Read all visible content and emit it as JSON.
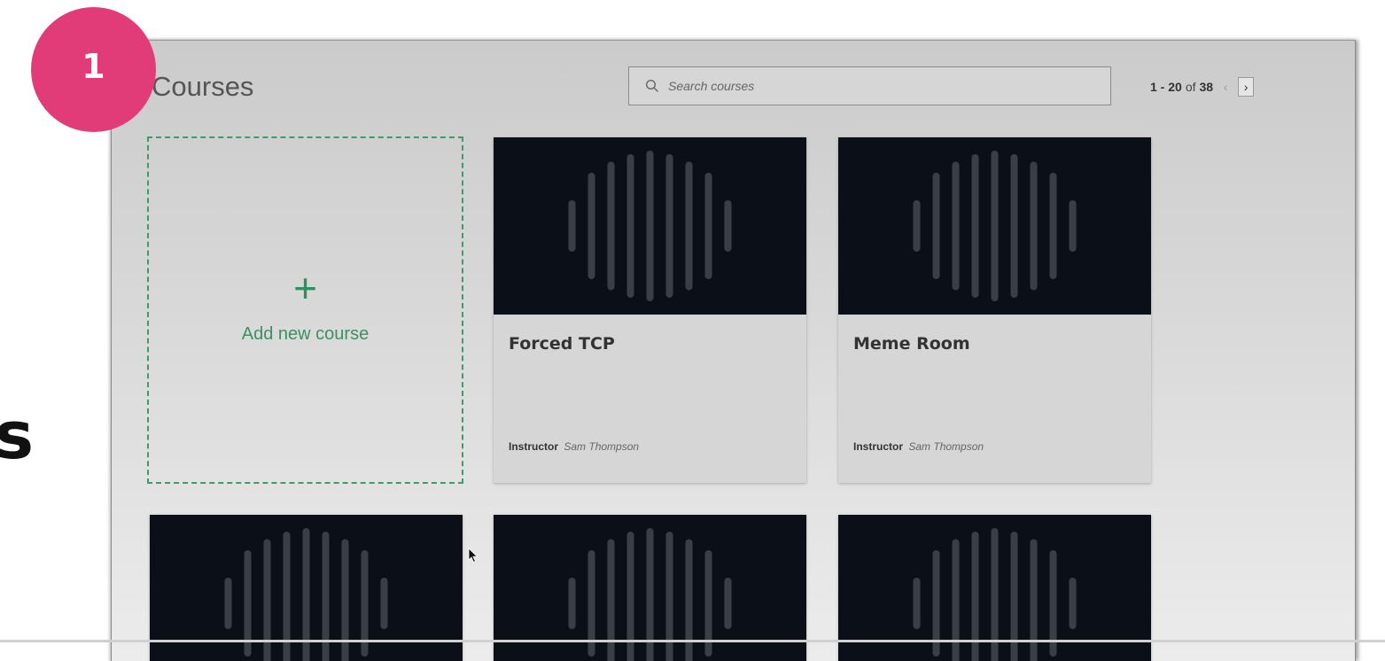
{
  "slide": {
    "fragment_text": "s",
    "step_number": "1"
  },
  "header": {
    "title": "Courses",
    "search_placeholder": "Search courses",
    "pagination": {
      "range": "1 - 20",
      "of": "of",
      "total": "38",
      "prev": "‹",
      "next": "›"
    }
  },
  "add_course": {
    "label": "Add new course",
    "icon": "plus-icon"
  },
  "courses": [
    {
      "title": "Forced TCP",
      "instructor_label": "Instructor",
      "instructor_name": "Sam Thompson"
    },
    {
      "title": "Meme Room",
      "instructor_label": "Instructor",
      "instructor_name": "Sam Thompson"
    }
  ],
  "colors": {
    "badge": "#e23c78",
    "accent_green": "#3d8f63",
    "thumb_bg": "#0b0f18",
    "bar": "#3a3f47"
  }
}
